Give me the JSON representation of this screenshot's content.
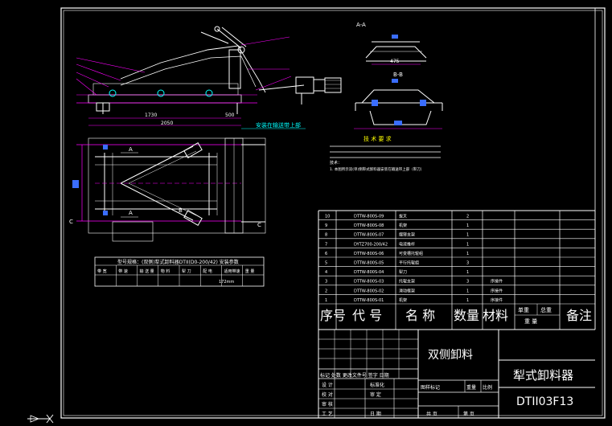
{
  "drawing": {
    "section_label_aa": "A-A",
    "section_label_bb": "B-B",
    "dim_1730": "1730",
    "dim_2050": "2050",
    "dim_500": "500",
    "dim_475": "475",
    "cyan_note": "安装在输送带上部",
    "tech_req_title": "技 术 要 求",
    "tech_req_line1": "技术：",
    "tech_req_line2": "1. 本图所示双(单)侧犁式卸料器安装在输送带上部（犁刀）",
    "spec_table_title": "型号规格：(双侧)犁式卸料器DTII(D0-200/42)  安装参数",
    "spec_table_headers": [
      "带 宽",
      "带 速",
      "输 送 量",
      "物 料",
      "犁 刀",
      "配 电",
      "适用带速",
      "重 量"
    ],
    "spec_table_weight": "172mm",
    "label_a1": "A",
    "label_a2": "A",
    "label_b": "B",
    "label_c1": "C",
    "label_c2": "C"
  },
  "bom": {
    "rows": [
      {
        "no": "10",
        "code": "DTTW-800S-09",
        "name": "拔叉",
        "qty": "2",
        "note": ""
      },
      {
        "no": "9",
        "code": "DTTW-800S-08",
        "name": "机架",
        "qty": "1",
        "note": ""
      },
      {
        "no": "8",
        "code": "DTTW-800S-07",
        "name": "摆臂支架",
        "qty": "1",
        "note": ""
      },
      {
        "no": "7",
        "code": "DYTZ700-200/42",
        "name": "电液推杆",
        "qty": "1",
        "note": ""
      },
      {
        "no": "6",
        "code": "DTTW-800S-06",
        "name": "可变槽托辊组",
        "qty": "1",
        "note": ""
      },
      {
        "no": "5",
        "code": "DTTW-800S-05",
        "name": "平行托辊组",
        "qty": "3",
        "note": ""
      },
      {
        "no": "4",
        "code": "DTTW-800S-04",
        "name": "犁刀",
        "qty": "1",
        "note": ""
      },
      {
        "no": "3",
        "code": "DTTW-800S-03",
        "name": "托辊支架",
        "qty": "3",
        "note": "序接件"
      },
      {
        "no": "2",
        "code": "DTTW-800S-02",
        "name": "滑动框架",
        "qty": "1",
        "note": "序接件"
      },
      {
        "no": "1",
        "code": "DTTW-800S-01",
        "name": "机架",
        "qty": "1",
        "note": "序接件"
      }
    ],
    "header": {
      "no": "序号",
      "code": "代  号",
      "name": "名  称",
      "qty": "数量",
      "material": "材料",
      "unit_weight": "单重",
      "total_weight": "总重",
      "weight": "重  量",
      "remark": "备注"
    }
  },
  "title_block": {
    "subtitle": "双侧卸料",
    "title": "犁式卸料器",
    "drawing_no": "DTII03F13",
    "row_labels": [
      "标记",
      "处数",
      "更改文件号",
      "签字",
      "日期"
    ],
    "design": "设  计",
    "standard": "标准化",
    "check": "校  对",
    "review": "审  定",
    "audit": "审  核",
    "process": "工  艺",
    "date": "日  期",
    "stage": "图样标记",
    "weight": "重量",
    "scale": "比例",
    "sheets_total": "共     页",
    "sheet_no": "第     页"
  }
}
